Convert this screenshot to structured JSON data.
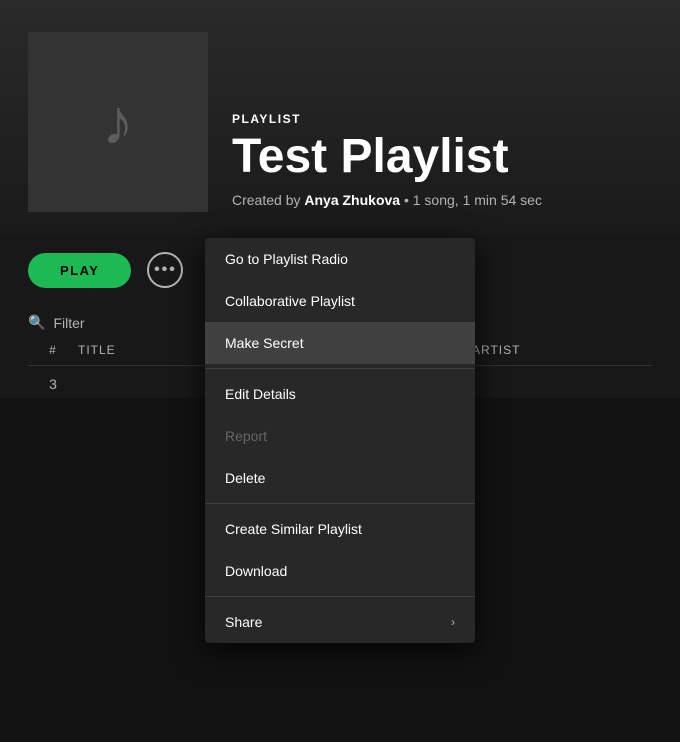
{
  "header": {
    "label": "PLAYLIST",
    "title": "Test Playlist",
    "created_by": "Created by",
    "creator": "Anya Zhukova",
    "meta": "• 1 song, 1 min 54 sec"
  },
  "controls": {
    "play_label": "PLAY",
    "more_icon": "···"
  },
  "filter": {
    "placeholder": "Filter"
  },
  "table": {
    "col_num": "#",
    "col_title": "TITLE",
    "col_artist": "ARTIST",
    "track_number": "3"
  },
  "context_menu": {
    "items": [
      {
        "label": "Go to Playlist Radio",
        "disabled": false,
        "active": false,
        "has_chevron": false
      },
      {
        "label": "Collaborative Playlist",
        "disabled": false,
        "active": false,
        "has_chevron": false
      },
      {
        "label": "Make Secret",
        "disabled": false,
        "active": true,
        "has_chevron": false
      },
      {
        "label": "Edit Details",
        "disabled": false,
        "active": false,
        "has_chevron": false
      },
      {
        "label": "Report",
        "disabled": true,
        "active": false,
        "has_chevron": false
      },
      {
        "label": "Delete",
        "disabled": false,
        "active": false,
        "has_chevron": false
      },
      {
        "label": "Create Similar Playlist",
        "disabled": false,
        "active": false,
        "has_chevron": false
      },
      {
        "label": "Download",
        "disabled": false,
        "active": false,
        "has_chevron": false
      },
      {
        "label": "Share",
        "disabled": false,
        "active": false,
        "has_chevron": true
      }
    ]
  },
  "icons": {
    "music_note": "♪",
    "search": "🔍",
    "chevron_right": "›"
  },
  "colors": {
    "green": "#1db954",
    "dark_bg": "#121212",
    "card_bg": "#282828",
    "text_secondary": "#b3b3b3"
  }
}
